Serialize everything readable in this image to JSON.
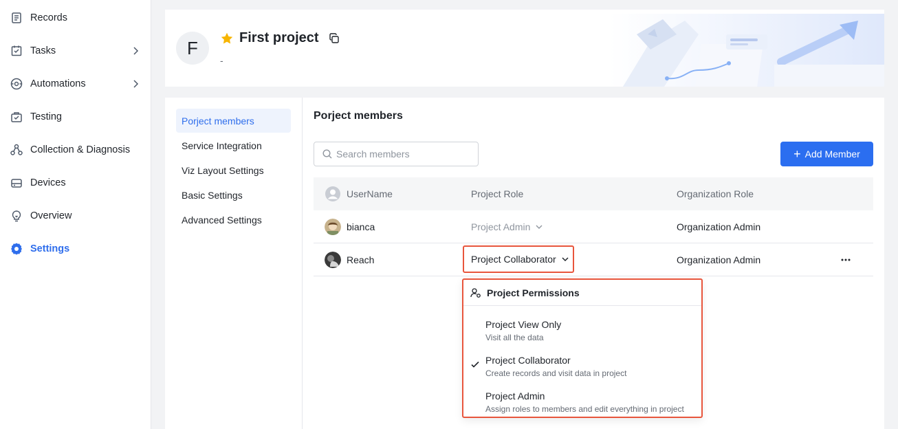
{
  "sidebar": {
    "items": [
      {
        "label": "Records",
        "icon": "records-icon",
        "has_chevron": false
      },
      {
        "label": "Tasks",
        "icon": "tasks-icon",
        "has_chevron": true
      },
      {
        "label": "Automations",
        "icon": "automations-icon",
        "has_chevron": true
      },
      {
        "label": "Testing",
        "icon": "testing-icon",
        "has_chevron": false
      },
      {
        "label": "Collection & Diagnosis",
        "icon": "collection-icon",
        "has_chevron": false
      },
      {
        "label": "Devices",
        "icon": "devices-icon",
        "has_chevron": false
      },
      {
        "label": "Overview",
        "icon": "overview-icon",
        "has_chevron": false
      },
      {
        "label": "Settings",
        "icon": "gear-icon",
        "has_chevron": false,
        "active": true
      }
    ]
  },
  "project": {
    "avatar_letter": "F",
    "title": "First project",
    "description": "-",
    "starred": true
  },
  "settings_nav": {
    "items": [
      {
        "label": "Porject members",
        "active": true
      },
      {
        "label": "Service Integration"
      },
      {
        "label": "Viz Layout Settings"
      },
      {
        "label": "Basic Settings"
      },
      {
        "label": "Advanced Settings"
      }
    ]
  },
  "members": {
    "title": "Porject members",
    "search_placeholder": "Search members",
    "add_button_label": "Add Member",
    "columns": {
      "username": "UserName",
      "project_role": "Project Role",
      "org_role": "Organization Role"
    },
    "rows": [
      {
        "name": "bianca",
        "project_role": "Project Admin",
        "org_role": "Organization Admin"
      },
      {
        "name": "Reach",
        "project_role": "Project Collaborator",
        "org_role": "Organization Admin"
      }
    ]
  },
  "role_dropdown": {
    "header": "Project Permissions",
    "options": [
      {
        "label": "Project View Only",
        "desc": "Visit all the data",
        "selected": false
      },
      {
        "label": "Project Collaborator",
        "desc": "Create records and visit data in project",
        "selected": true
      },
      {
        "label": "Project Admin",
        "desc": "Assign roles to members and edit everything in project",
        "selected": false
      }
    ]
  },
  "colors": {
    "accent": "#2b6ef0",
    "highlight_border": "#e8553c",
    "star": "#f7b500"
  }
}
